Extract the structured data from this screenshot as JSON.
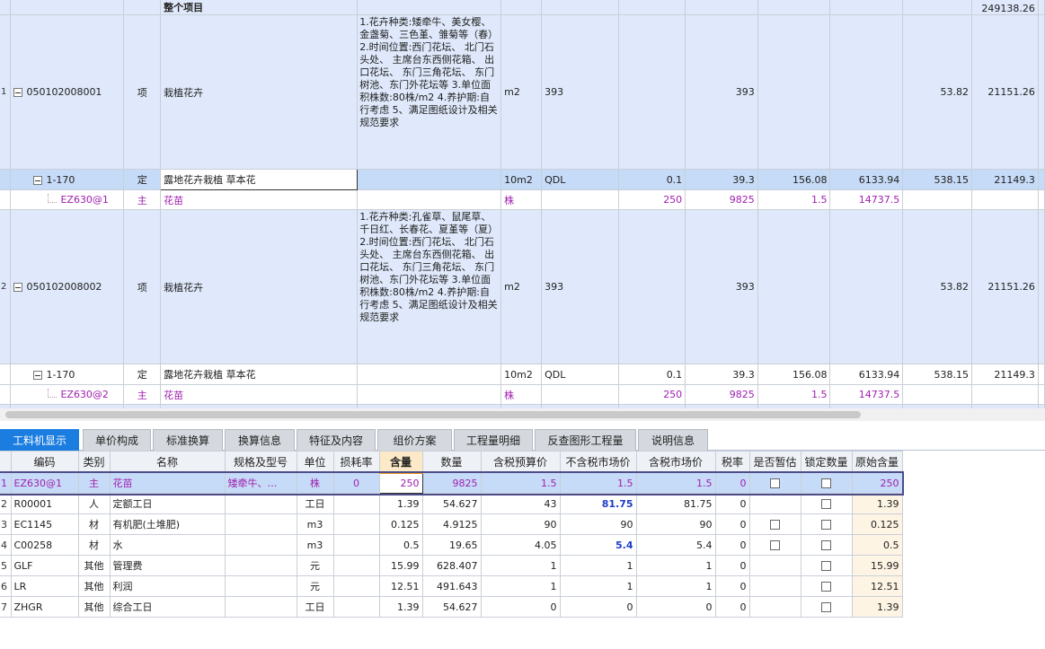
{
  "upper": {
    "partial_row": {
      "name": "整个项目",
      "total": "249138.26"
    },
    "rows": [
      {
        "kind": "list",
        "index": "1",
        "code": "050102008001",
        "type": "项",
        "name": "栽植花卉",
        "desc": "1.花卉种类:矮牵牛、美女樱、金盏菊、三色堇、雏菊等（春）\n2.时间位置:西门花坛、 北门石头处、 主席台东西侧花箱、 出口花坛、 东门三角花坛、 东门树池、东门外花坛等\n3.单位面积株数:80株/m2\n4.养护期:自行考虑\n5、满足图纸设计及相关规范要求",
        "unit": "m2",
        "expr": "393",
        "qty": "",
        "qty2": "393",
        "price": "",
        "total": "",
        "unit_price": "53.82",
        "sum": "21151.26"
      },
      {
        "kind": "quota",
        "selected": true,
        "code": "1-170",
        "type": "定",
        "name": "露地花卉栽植 草本花",
        "desc": "",
        "unit": "10m2",
        "expr": "QDL",
        "qty": "0.1",
        "qty2": "39.3",
        "price": "156.08",
        "total": "6133.94",
        "unit_price": "538.15",
        "sum": "21149.3"
      },
      {
        "kind": "mat",
        "code": "EZ630@1",
        "type": "主",
        "name": "花苗",
        "desc": "",
        "unit": "株",
        "expr": "",
        "qty": "250",
        "qty2": "9825",
        "price": "1.5",
        "total": "14737.5",
        "unit_price": "",
        "sum": ""
      },
      {
        "kind": "list",
        "index": "2",
        "code": "050102008002",
        "type": "项",
        "name": "栽植花卉",
        "desc": "1.花卉种类:孔雀草、鼠尾草、千日红、长春花、夏堇等（夏）\n2.时间位置:西门花坛、 北门石头处、 主席台东西侧花箱、 出口花坛、 东门三角花坛、 东门树池、东门外花坛等\n3.单位面积株数:80株/m2\n4.养护期:自行考虑\n5、满足图纸设计及相关规范要求",
        "unit": "m2",
        "expr": "393",
        "qty": "",
        "qty2": "393",
        "price": "",
        "total": "",
        "unit_price": "53.82",
        "sum": "21151.26"
      },
      {
        "kind": "quota",
        "selected": false,
        "code": "1-170",
        "type": "定",
        "name": "露地花卉栽植 草本花",
        "desc": "",
        "unit": "10m2",
        "expr": "QDL",
        "qty": "0.1",
        "qty2": "39.3",
        "price": "156.08",
        "total": "6133.94",
        "unit_price": "538.15",
        "sum": "21149.3"
      },
      {
        "kind": "mat",
        "code": "EZ630@2",
        "type": "主",
        "name": "花苗",
        "desc": "",
        "unit": "株",
        "expr": "",
        "qty": "250",
        "qty2": "9825",
        "price": "1.5",
        "total": "14737.5",
        "unit_price": "",
        "sum": ""
      }
    ]
  },
  "tabs": [
    {
      "label": "工料机显示",
      "active": true
    },
    {
      "label": "单价构成"
    },
    {
      "label": "标准换算"
    },
    {
      "label": "换算信息"
    },
    {
      "label": "特征及内容"
    },
    {
      "label": "组价方案"
    },
    {
      "label": "工程量明细"
    },
    {
      "label": "反查图形工程量"
    },
    {
      "label": "说明信息"
    }
  ],
  "lower": {
    "headers": [
      "编码",
      "类别",
      "名称",
      "规格及型号",
      "单位",
      "损耗率",
      "含量",
      "数量",
      "含税预算价",
      "不含税市场价",
      "含税市场价",
      "税率",
      "是否暂估",
      "锁定数量",
      "原始含量"
    ],
    "rows": [
      {
        "index": "1",
        "code": "EZ630@1",
        "type": "主",
        "name": "花苗",
        "spec": "矮牵牛、…",
        "unit": "株",
        "loss": "0",
        "content": "250",
        "qty": "9825",
        "budget": "1.5",
        "market_ex": "1.5",
        "market_in": "1.5",
        "tax": "0",
        "est_check": true,
        "lock_check": true,
        "orig": "250",
        "selected": true
      },
      {
        "index": "2",
        "code": "R00001",
        "type": "人",
        "name": "定额工日",
        "spec": "",
        "unit": "工日",
        "loss": "",
        "content": "1.39",
        "qty": "54.627",
        "budget": "43",
        "market_ex": "81.75",
        "market_in": "81.75",
        "tax": "0",
        "est_check": false,
        "lock_check": true,
        "orig": "1.39",
        "bold": true
      },
      {
        "index": "3",
        "code": "EC1145",
        "type": "材",
        "name": "有机肥(土堆肥)",
        "spec": "",
        "unit": "m3",
        "loss": "",
        "content": "0.125",
        "qty": "4.9125",
        "budget": "90",
        "market_ex": "90",
        "market_in": "90",
        "tax": "0",
        "est_check": true,
        "lock_check": true,
        "orig": "0.125"
      },
      {
        "index": "4",
        "code": "C00258",
        "type": "材",
        "name": "水",
        "spec": "",
        "unit": "m3",
        "loss": "",
        "content": "0.5",
        "qty": "19.65",
        "budget": "4.05",
        "market_ex": "5.4",
        "market_in": "5.4",
        "tax": "0",
        "est_check": true,
        "lock_check": true,
        "orig": "0.5",
        "bold": true
      },
      {
        "index": "5",
        "code": "GLF",
        "type": "其他",
        "name": "管理费",
        "spec": "",
        "unit": "元",
        "loss": "",
        "content": "15.99",
        "qty": "628.407",
        "budget": "1",
        "market_ex": "1",
        "market_in": "1",
        "tax": "0",
        "est_check": false,
        "lock_check": true,
        "orig": "15.99"
      },
      {
        "index": "6",
        "code": "LR",
        "type": "其他",
        "name": "利润",
        "spec": "",
        "unit": "元",
        "loss": "",
        "content": "12.51",
        "qty": "491.643",
        "budget": "1",
        "market_ex": "1",
        "market_in": "1",
        "tax": "0",
        "est_check": false,
        "lock_check": true,
        "orig": "12.51"
      },
      {
        "index": "7",
        "code": "ZHGR",
        "type": "其他",
        "name": "综合工日",
        "spec": "",
        "unit": "工日",
        "loss": "",
        "content": "1.39",
        "qty": "54.627",
        "budget": "0",
        "market_ex": "0",
        "market_in": "0",
        "tax": "0",
        "est_check": false,
        "lock_check": true,
        "orig": "1.39"
      }
    ]
  }
}
